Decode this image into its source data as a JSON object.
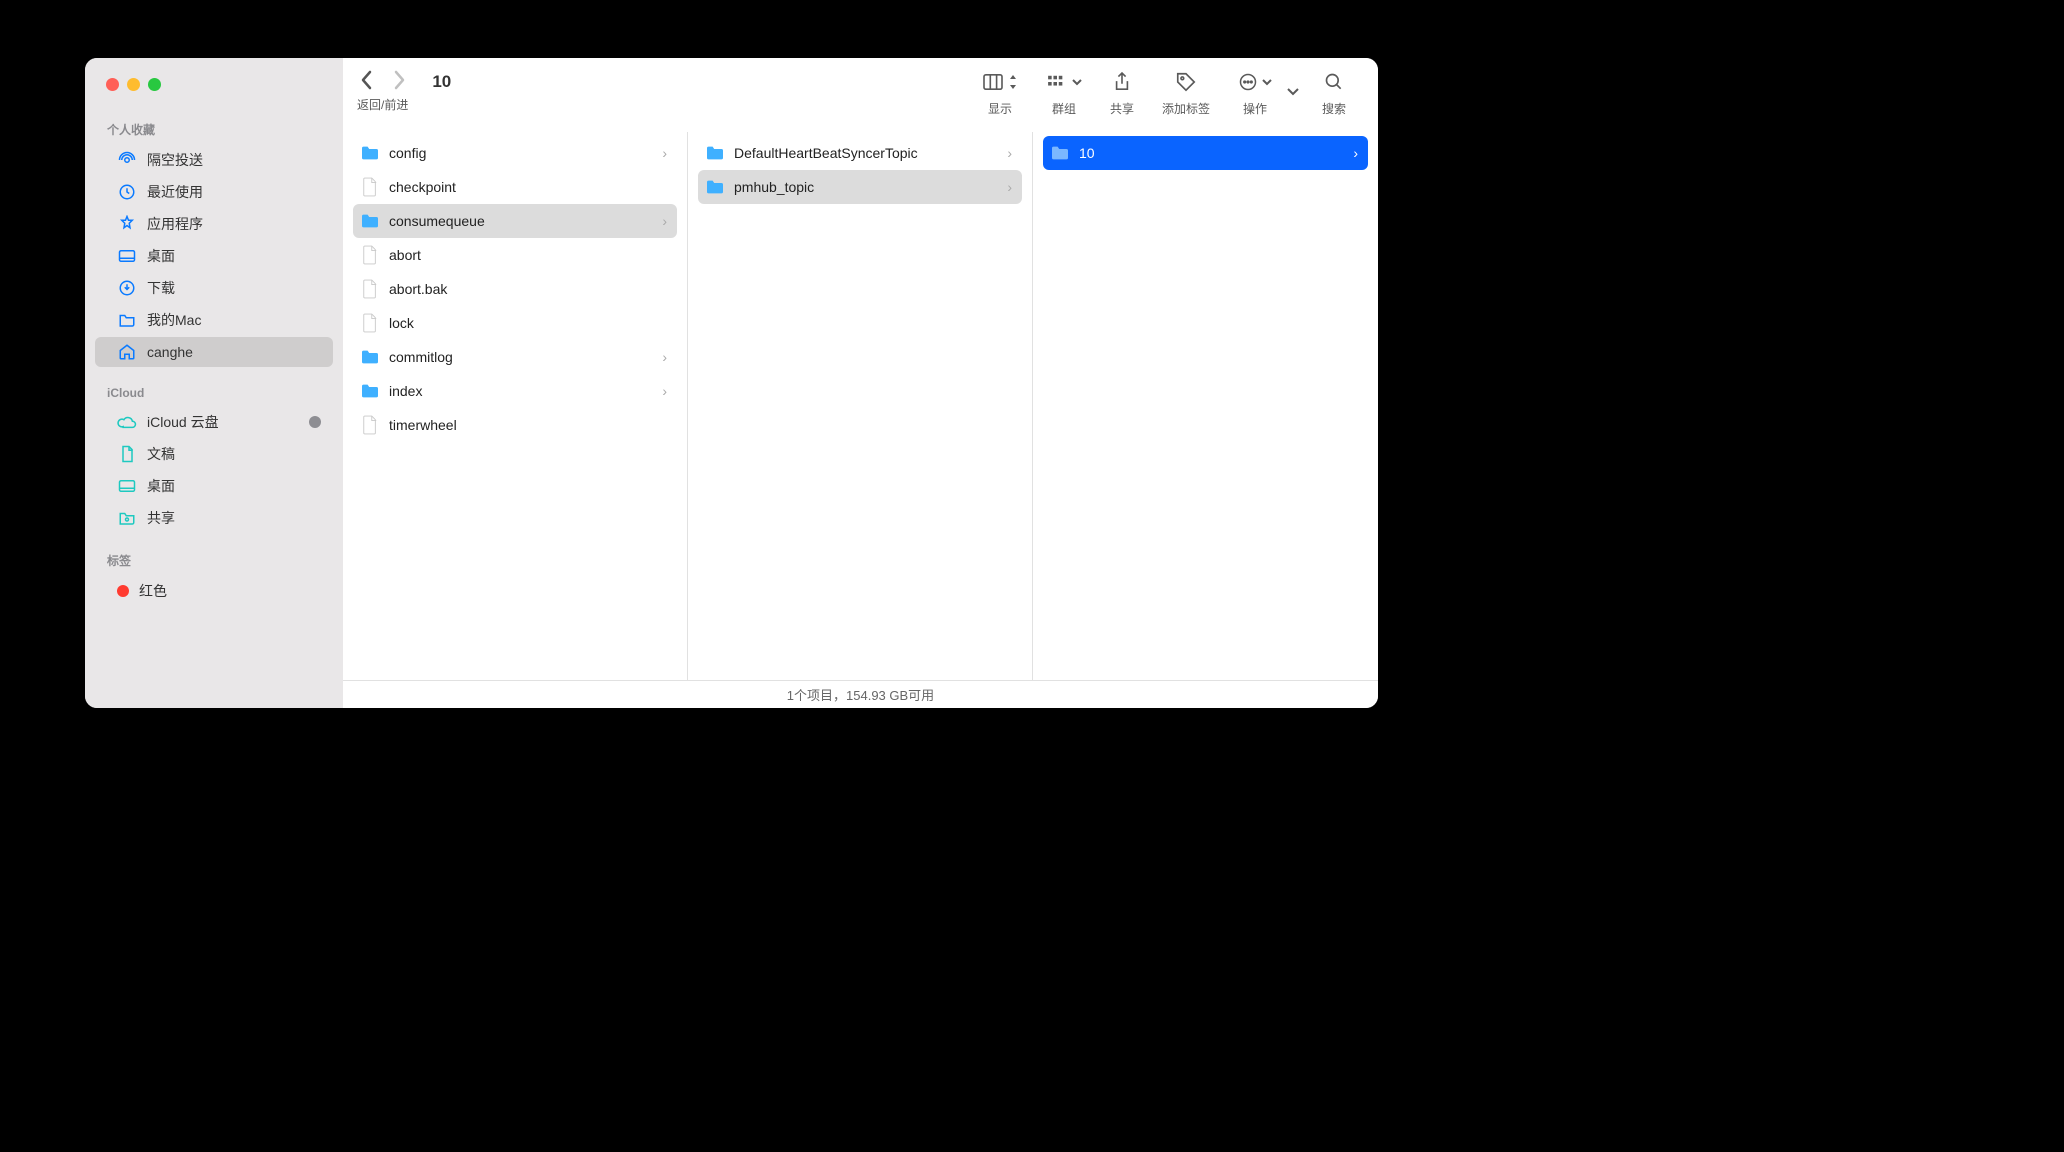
{
  "window": {
    "title": "10"
  },
  "toolbar": {
    "nav_caption": "返回/前进",
    "view_label": "显示",
    "group_label": "群组",
    "share_label": "共享",
    "tag_label": "添加标签",
    "action_label": "操作",
    "search_label": "搜索"
  },
  "sidebar": {
    "favorites_title": "个人收藏",
    "favorites": [
      {
        "label": "隔空投送",
        "icon": "airdrop"
      },
      {
        "label": "最近使用",
        "icon": "clock"
      },
      {
        "label": "应用程序",
        "icon": "apps"
      },
      {
        "label": "桌面",
        "icon": "desktop"
      },
      {
        "label": "下载",
        "icon": "download"
      },
      {
        "label": "我的Mac",
        "icon": "folder"
      },
      {
        "label": "canghe",
        "icon": "home",
        "selected": true
      }
    ],
    "icloud_title": "iCloud",
    "icloud": [
      {
        "label": "iCloud 云盘",
        "icon": "cloud",
        "dot": true
      },
      {
        "label": "文稿",
        "icon": "doc"
      },
      {
        "label": "桌面",
        "icon": "desktop"
      },
      {
        "label": "共享",
        "icon": "sharefolder"
      }
    ],
    "tags_title": "标签",
    "tags": [
      {
        "label": "红色",
        "color": "#ff3b30"
      }
    ]
  },
  "columns": {
    "c1": [
      {
        "label": "config",
        "type": "folder",
        "arrow": true
      },
      {
        "label": "checkpoint",
        "type": "file"
      },
      {
        "label": "consumequeue",
        "type": "folder",
        "arrow": true,
        "path": true
      },
      {
        "label": "abort",
        "type": "file"
      },
      {
        "label": "abort.bak",
        "type": "file"
      },
      {
        "label": "lock",
        "type": "file"
      },
      {
        "label": "commitlog",
        "type": "folder",
        "arrow": true
      },
      {
        "label": "index",
        "type": "folder",
        "arrow": true
      },
      {
        "label": "timerwheel",
        "type": "file"
      }
    ],
    "c2": [
      {
        "label": "DefaultHeartBeatSyncerTopic",
        "type": "folder",
        "arrow": true
      },
      {
        "label": "pmhub_topic",
        "type": "folder",
        "arrow": true,
        "path": true
      }
    ],
    "c3": [
      {
        "label": "10",
        "type": "folder",
        "arrow": true,
        "active": true
      }
    ]
  },
  "status": "1个项目，154.93 GB可用"
}
